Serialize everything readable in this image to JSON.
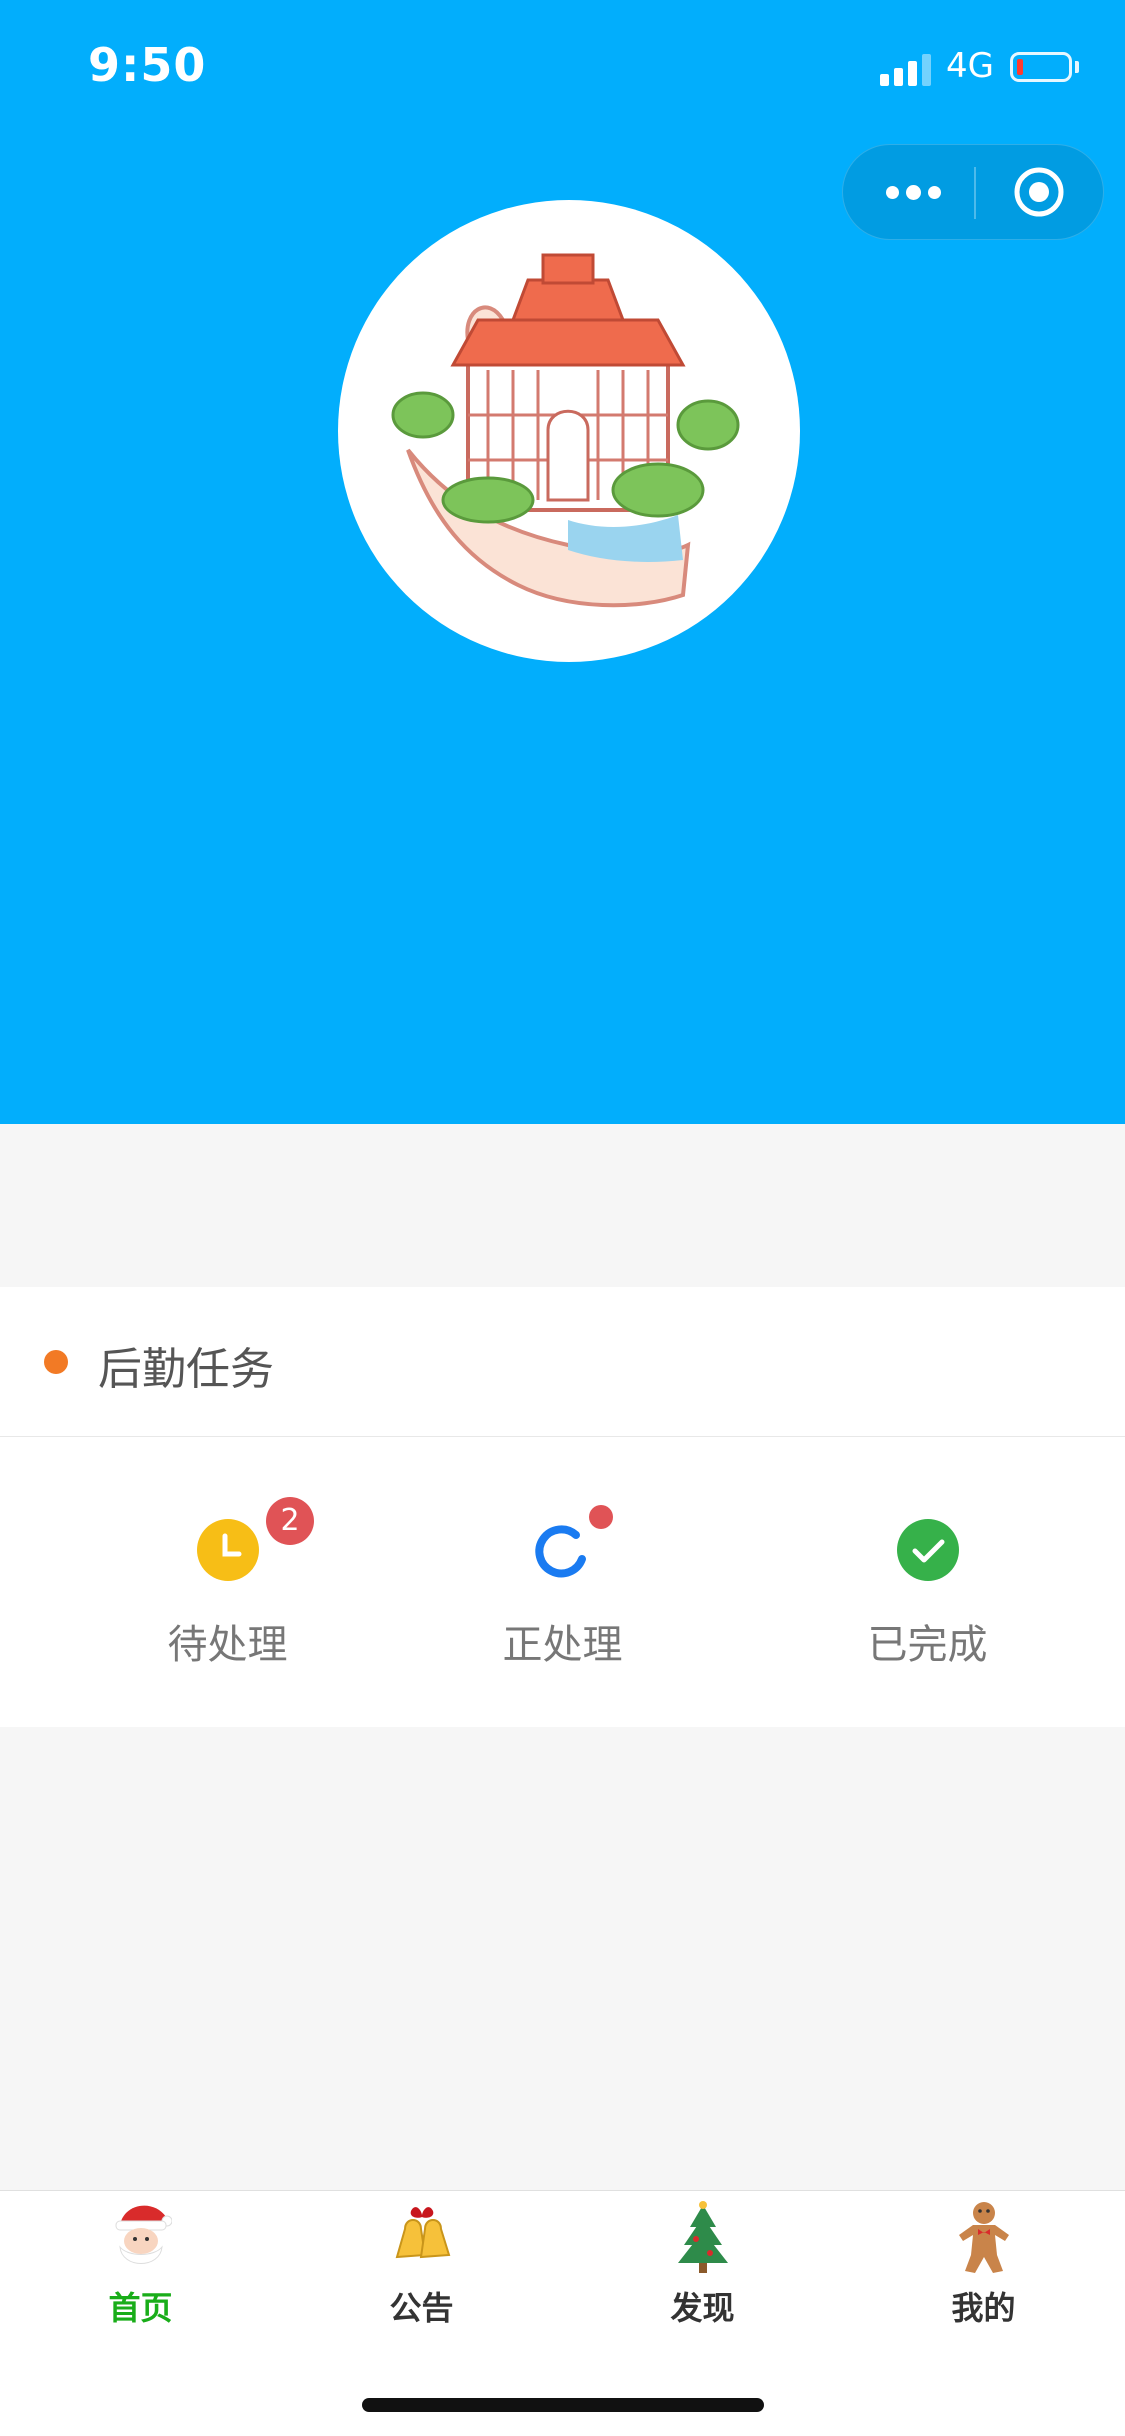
{
  "status_bar": {
    "time": "9:50",
    "network": "4G",
    "battery_color": "#ff3b30"
  },
  "header": {
    "background": "#02aefc"
  },
  "capsule": {
    "more_icon": "more-dots-icon",
    "close_icon": "target-close-icon"
  },
  "logistics": {
    "title": "后勤任务",
    "accent": "#f27a25",
    "items": [
      {
        "label": "待处理",
        "icon": "clock-icon",
        "color": "#f7be16",
        "badge": "2"
      },
      {
        "label": "正处理",
        "icon": "loading-icon",
        "color": "#1a7bf1",
        "dot": true
      },
      {
        "label": "已完成",
        "icon": "check-circle-icon",
        "color": "#36b14a"
      }
    ]
  },
  "tabbar": {
    "active_color": "#19ad19",
    "items": [
      {
        "label": "首页",
        "icon": "santa-icon",
        "active": true
      },
      {
        "label": "公告",
        "icon": "bells-icon",
        "active": false
      },
      {
        "label": "发现",
        "icon": "christmas-tree-icon",
        "active": false
      },
      {
        "label": "我的",
        "icon": "gingerbread-icon",
        "active": false
      }
    ]
  }
}
